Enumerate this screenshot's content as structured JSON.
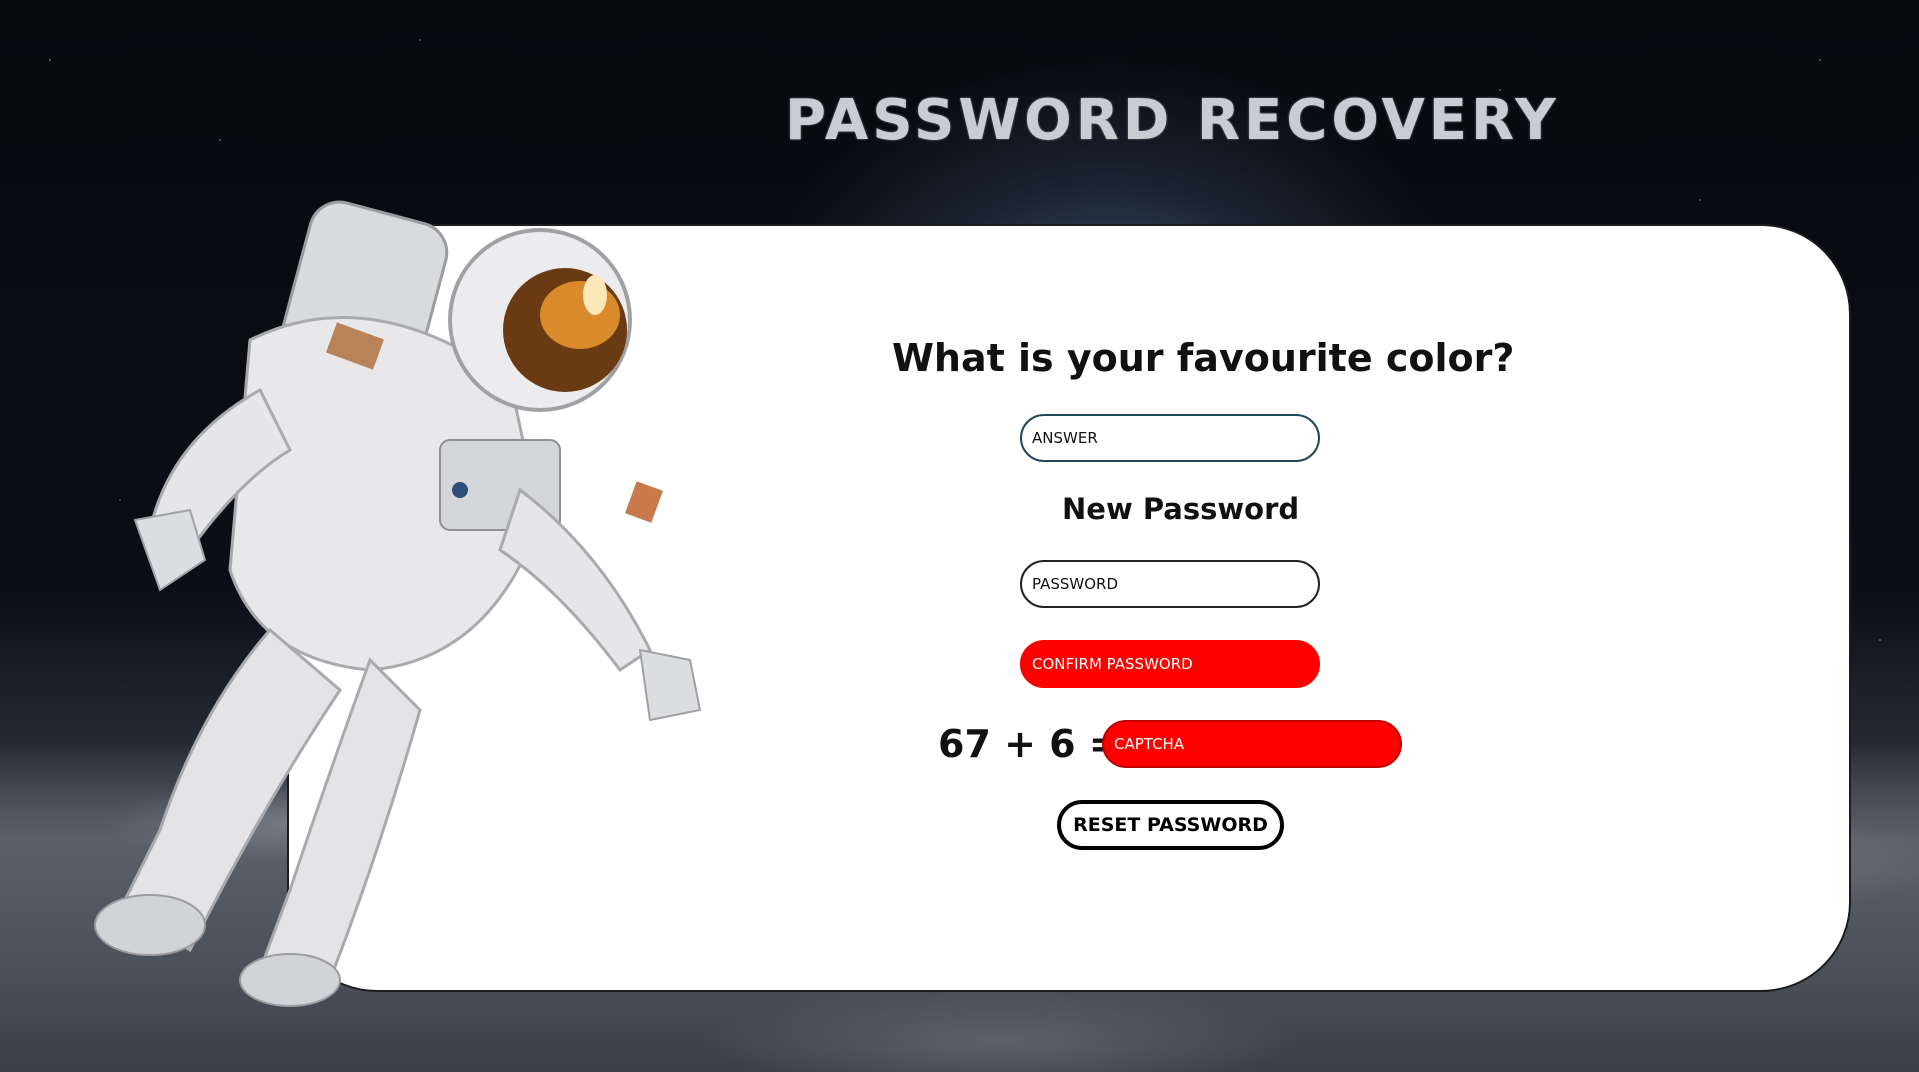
{
  "header": {
    "title": "PASSWORD RECOVERY"
  },
  "form": {
    "question": "What is your favourite color?",
    "answer_placeholder": "ANSWER",
    "new_password_label": "New Password",
    "password_placeholder": "PASSWORD",
    "confirm_placeholder": "CONFIRM PASSWORD",
    "captcha_question": "67 + 6 =",
    "captcha_placeholder": "CAPTCHA",
    "reset_label": "RESET PASSWORD"
  },
  "colors": {
    "error_field": "#ff0000",
    "card_background": "#ffffff"
  },
  "illustration": {
    "subject": "astronaut-icon"
  }
}
